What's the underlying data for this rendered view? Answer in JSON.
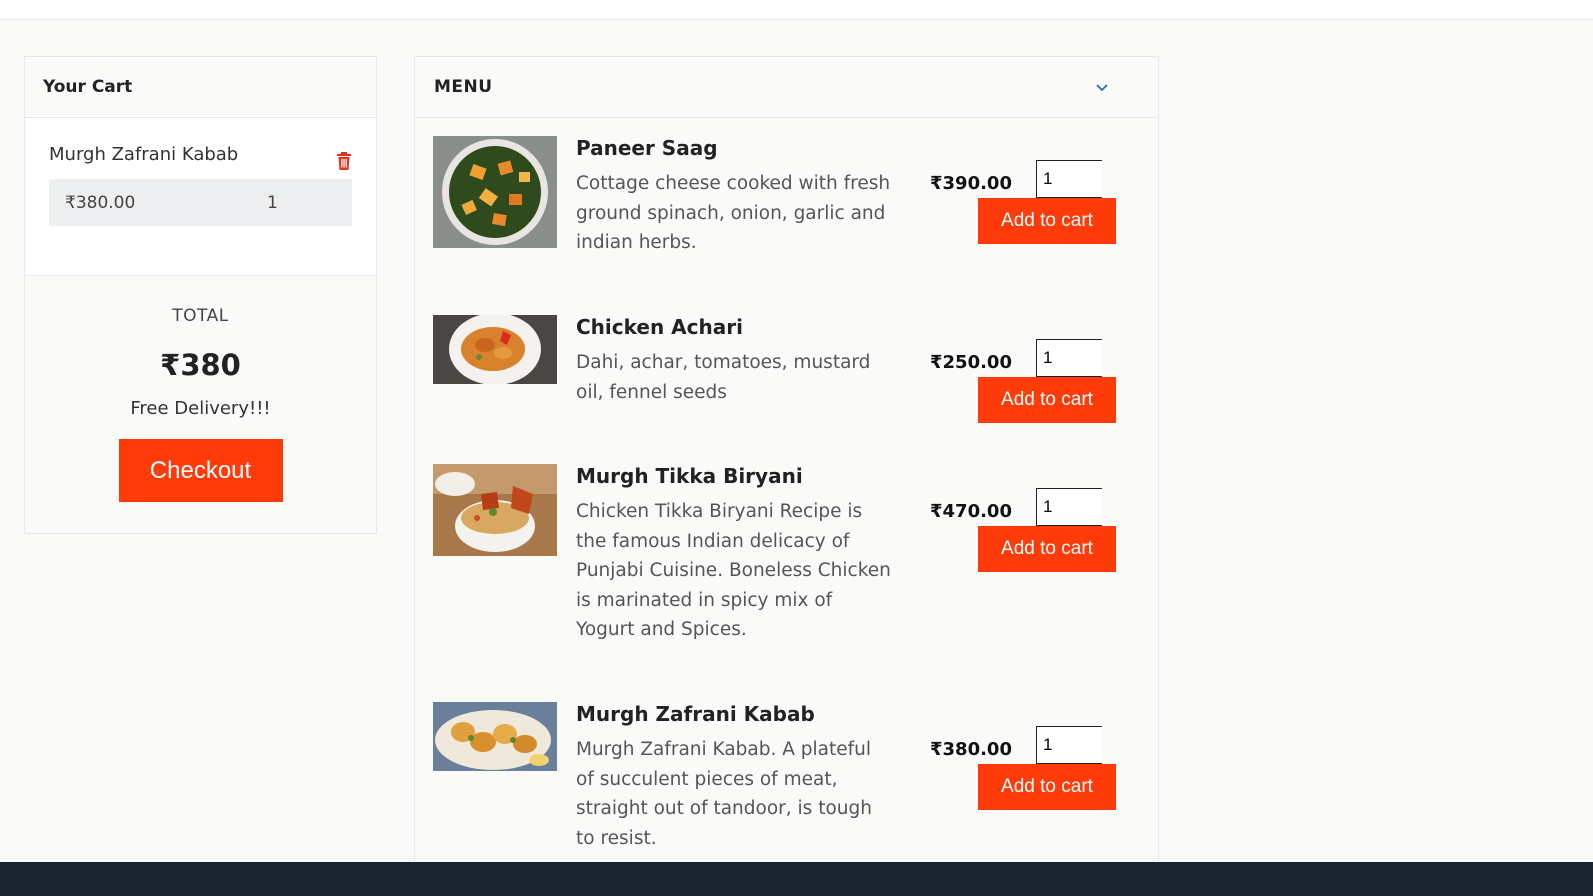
{
  "cart": {
    "title": "Your Cart",
    "items": [
      {
        "name": "Murgh Zafrani Kabab",
        "price": "₹380.00",
        "qty": "1"
      }
    ],
    "total_label": "TOTAL",
    "total_amount": "₹380",
    "delivery_note": "Free Delivery!!!",
    "checkout_label": "Checkout",
    "trash_icon": "trash-icon"
  },
  "menu": {
    "title": "MENU",
    "chevron_icon": "chevron-down-icon",
    "add_label": "Add to cart",
    "items": [
      {
        "name": "Paneer Saag",
        "description": "Cottage cheese cooked with fresh ground spinach, onion, garlic and indian herbs.",
        "price": "₹390.00",
        "qty": "1"
      },
      {
        "name": "Chicken Achari",
        "description": "Dahi, achar, tomatoes, mustard oil, fennel seeds",
        "price": "₹250.00",
        "qty": "1"
      },
      {
        "name": "Murgh Tikka Biryani",
        "description": "Chicken Tikka Biryani Recipe is the famous Indian delicacy of Punjabi Cuisine. Boneless Chicken is marinated in spicy mix of Yogurt and Spices.",
        "price": "₹470.00",
        "qty": "1"
      },
      {
        "name": "Murgh Zafrani Kabab",
        "description": "Murgh Zafrani Kabab. A plateful of succulent pieces of meat, straight out of tandoor, is tough to resist.",
        "price": "₹380.00",
        "qty": "1"
      }
    ]
  },
  "colors": {
    "accent": "#ff3b0a",
    "footer": "#1c2331",
    "background": "#fafaf8"
  }
}
